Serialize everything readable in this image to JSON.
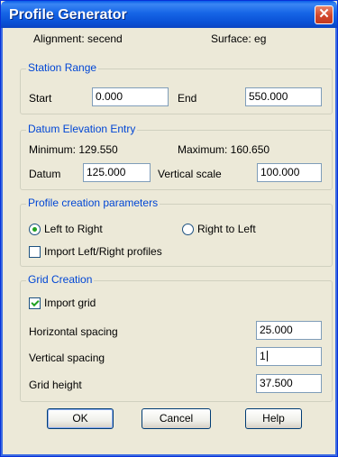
{
  "window": {
    "title": "Profile Generator",
    "close_glyph": "✕"
  },
  "info": {
    "alignment": "Alignment: secend",
    "surface": "Surface: eg"
  },
  "station_range": {
    "legend": "Station Range",
    "start_label": "Start",
    "start_value": "0.000",
    "end_label": "End",
    "end_value": "550.000"
  },
  "datum": {
    "legend": "Datum Elevation Entry",
    "minimum": "Minimum: 129.550",
    "maximum": "Maximum: 160.650",
    "datum_label": "Datum",
    "datum_value": "125.000",
    "vscale_label": "Vertical scale",
    "vscale_value": "100.000"
  },
  "profile": {
    "legend": "Profile creation parameters",
    "left_to_right": "Left to Right",
    "right_to_left": "Right to Left",
    "import_lr": "Import Left/Right profiles",
    "selected": "Left to Right",
    "import_lr_checked": false
  },
  "grid": {
    "legend": "Grid Creation",
    "import_grid": "Import grid",
    "import_grid_checked": true,
    "hspacing_label": "Horizontal spacing",
    "hspacing_value": "25.000",
    "vspacing_label": "Vertical spacing",
    "vspacing_value": "1",
    "height_label": "Grid height",
    "height_value": "37.500"
  },
  "buttons": {
    "ok": "OK",
    "cancel": "Cancel",
    "help": "Help"
  }
}
